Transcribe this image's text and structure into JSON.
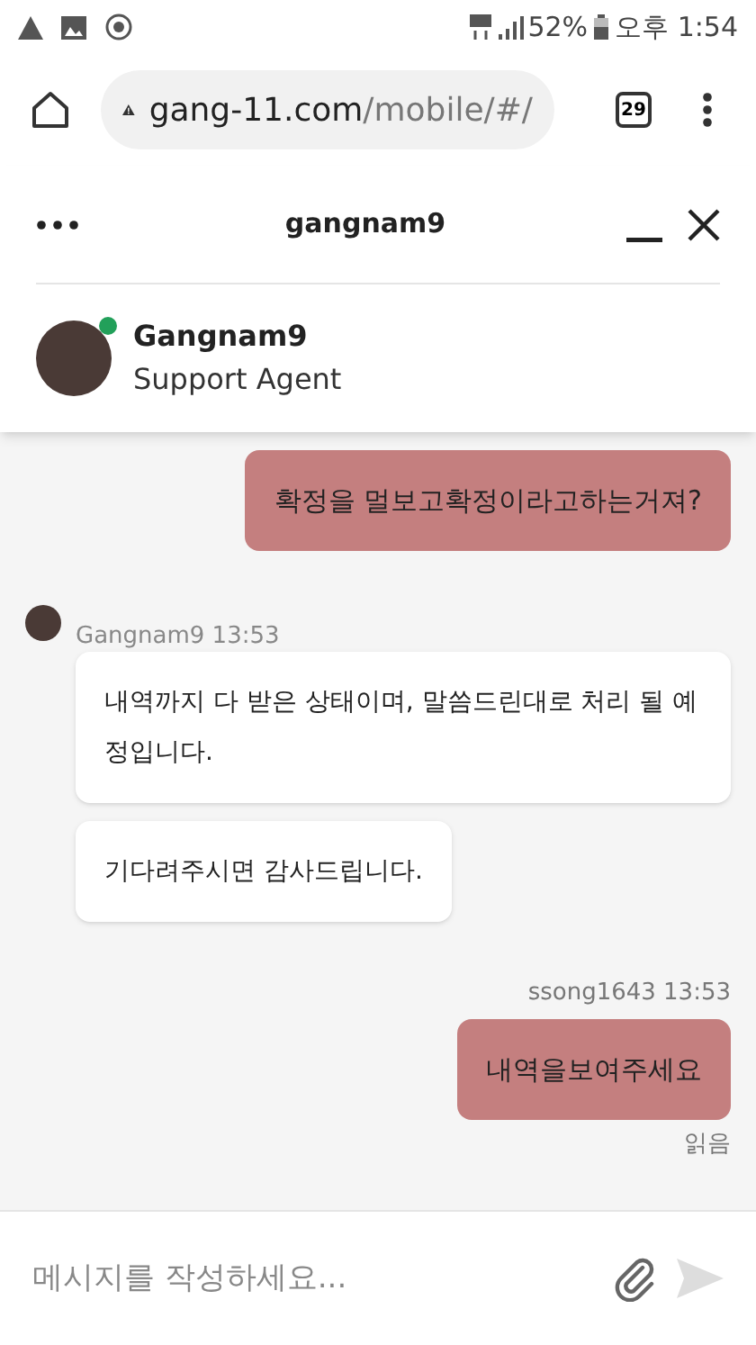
{
  "status_bar": {
    "battery_percent": "52%",
    "time": "오후 1:54"
  },
  "browser": {
    "url_host": "gang-11.com",
    "url_path": "/mobile/#/",
    "tab_count": "29"
  },
  "chat_header": {
    "title": "gangnam9",
    "agent": {
      "name": "Gangnam9",
      "role": "Support Agent",
      "online": true
    }
  },
  "thread": [
    {
      "kind": "outgoing",
      "text": "확정을 멀보고확정이라고하는거져?"
    },
    {
      "kind": "incoming_meta",
      "text": "Gangnam9 13:53"
    },
    {
      "kind": "incoming",
      "text": "내역까지 다 받은 상태이며, 말씀드린대로 처리 될 예정입니다."
    },
    {
      "kind": "incoming",
      "text": "기다려주시면 감사드립니다."
    },
    {
      "kind": "outgoing_meta",
      "text": "ssong1643 13:53"
    },
    {
      "kind": "outgoing",
      "text": "내역을보여주세요"
    },
    {
      "kind": "receipt",
      "text": "읽음"
    }
  ],
  "composer": {
    "placeholder": "메시지를 작성하세요..."
  }
}
